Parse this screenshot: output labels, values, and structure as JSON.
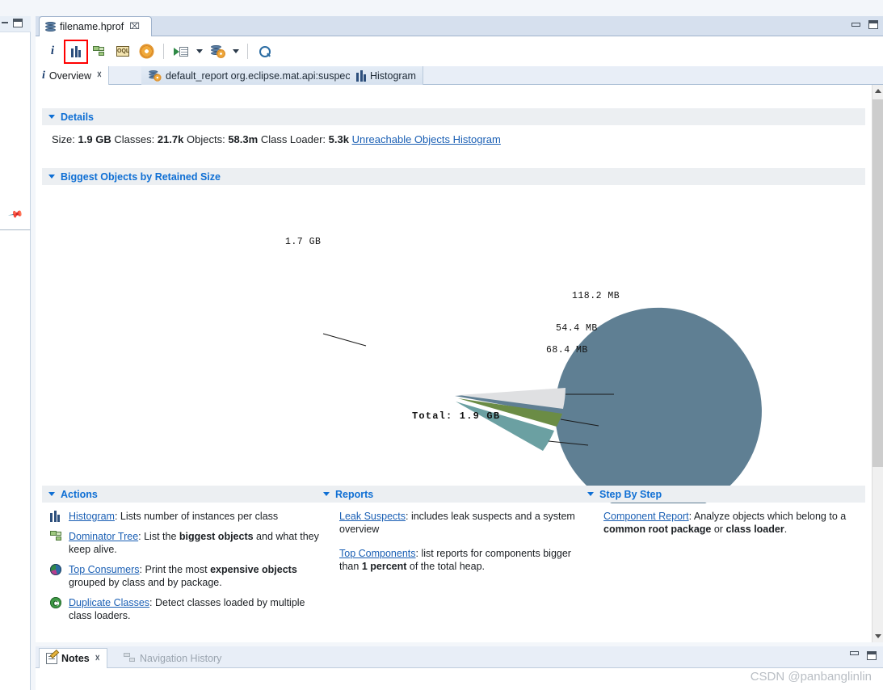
{
  "window": {
    "editor_tab": {
      "label": "filename.hprof",
      "icon": "heap-dump-icon",
      "close": "⌧"
    },
    "minimize_tooltip": "Minimize",
    "maximize_tooltip": "Maximize"
  },
  "toolbar": {
    "items": [
      {
        "name": "overview-info-icon",
        "label": "i"
      },
      {
        "name": "histogram-icon",
        "label": ""
      },
      {
        "name": "dominator-tree-icon",
        "label": ""
      },
      {
        "name": "oql-icon",
        "label": "OQL"
      },
      {
        "name": "settings-gear-icon",
        "label": ""
      },
      {
        "name": "run-expert-system-test-icon",
        "label": ""
      },
      {
        "name": "open-query-browser-icon",
        "label": ""
      },
      {
        "name": "find-icon",
        "label": ""
      }
    ]
  },
  "view_tabs": [
    {
      "label": "Overview",
      "icon": "info-icon",
      "active": true,
      "closable": true
    },
    {
      "label": "default_report  org.eclipse.mat.api:suspects",
      "icon": "report-icon",
      "active": false,
      "closable": false
    },
    {
      "label": "Histogram",
      "icon": "histogram-icon",
      "active": false,
      "closable": false
    }
  ],
  "details": {
    "header": "Details",
    "size_label": "Size:",
    "size_value": "1.9 GB",
    "classes_label": "Classes:",
    "classes_value": "21.7k",
    "objects_label": "Objects:",
    "objects_value": "58.3m",
    "class_loader_label": "Class Loader:",
    "class_loader_value": "5.3k",
    "link": "Unreachable Objects Histogram"
  },
  "biggest_objects": {
    "header": "Biggest Objects by Retained Size"
  },
  "chart_data": {
    "type": "pie",
    "title": "Biggest Objects by Retained Size",
    "total_label": "Total: 1.9 GB",
    "total_value": "1.9 GB",
    "unit_note": "retained size",
    "legend_position": "callout-labels",
    "slices": [
      {
        "label": "1.7 GB",
        "value": 1740.8,
        "unit": "MB",
        "display": "1.7 GB",
        "color": "#5f7f93",
        "exploded": false
      },
      {
        "label": "118.2 MB",
        "value": 118.2,
        "unit": "MB",
        "display": "118.2 MB",
        "color": "#dfe0e2",
        "exploded": true
      },
      {
        "label": "54.4 MB",
        "value": 54.4,
        "unit": "MB",
        "display": "54.4 MB",
        "color": "#6b8c45",
        "exploded": true
      },
      {
        "label": "68.4 MB",
        "value": 68.4,
        "unit": "MB",
        "display": "68.4 MB",
        "color": "#6ba0a2",
        "exploded": true
      }
    ]
  },
  "actions": {
    "header": "Actions",
    "items": [
      {
        "icon": "histogram-icon",
        "link": "Histogram",
        "rest": ": Lists number of instances per class"
      },
      {
        "icon": "dominator-tree-icon",
        "link": "Dominator Tree",
        "rest": ": List the ",
        "bold1": "biggest objects",
        "rest2": " and what they keep alive."
      },
      {
        "icon": "top-consumers-icon",
        "link": "Top Consumers",
        "rest": ": Print the most ",
        "bold1": "expensive objects",
        "rest2": " grouped by class and by package."
      },
      {
        "icon": "duplicate-classes-icon",
        "link": "Duplicate Classes",
        "rest": ": Detect classes loaded by multiple class loaders."
      }
    ]
  },
  "reports": {
    "header": "Reports",
    "items": [
      {
        "link": "Leak Suspects",
        "rest": ": includes leak suspects and a system overview"
      },
      {
        "link": "Top Components",
        "rest": ": list reports for components bigger than ",
        "bold1": "1 percent",
        "rest2": " of the total heap."
      }
    ]
  },
  "step_by_step": {
    "header": "Step By Step",
    "items": [
      {
        "link": "Component Report",
        "rest": ": Analyze objects which belong to a ",
        "bold1": "common root package",
        "mid": " or ",
        "bold2": "class loader",
        "rest2": "."
      }
    ]
  },
  "bottom_tabs": [
    {
      "label": "Notes",
      "icon": "notes-icon",
      "active": true,
      "closable": true
    },
    {
      "label": "Navigation History",
      "icon": "navigation-history-icon",
      "active": false,
      "closable": false
    }
  ],
  "watermark": "CSDN @panbanglinlin"
}
